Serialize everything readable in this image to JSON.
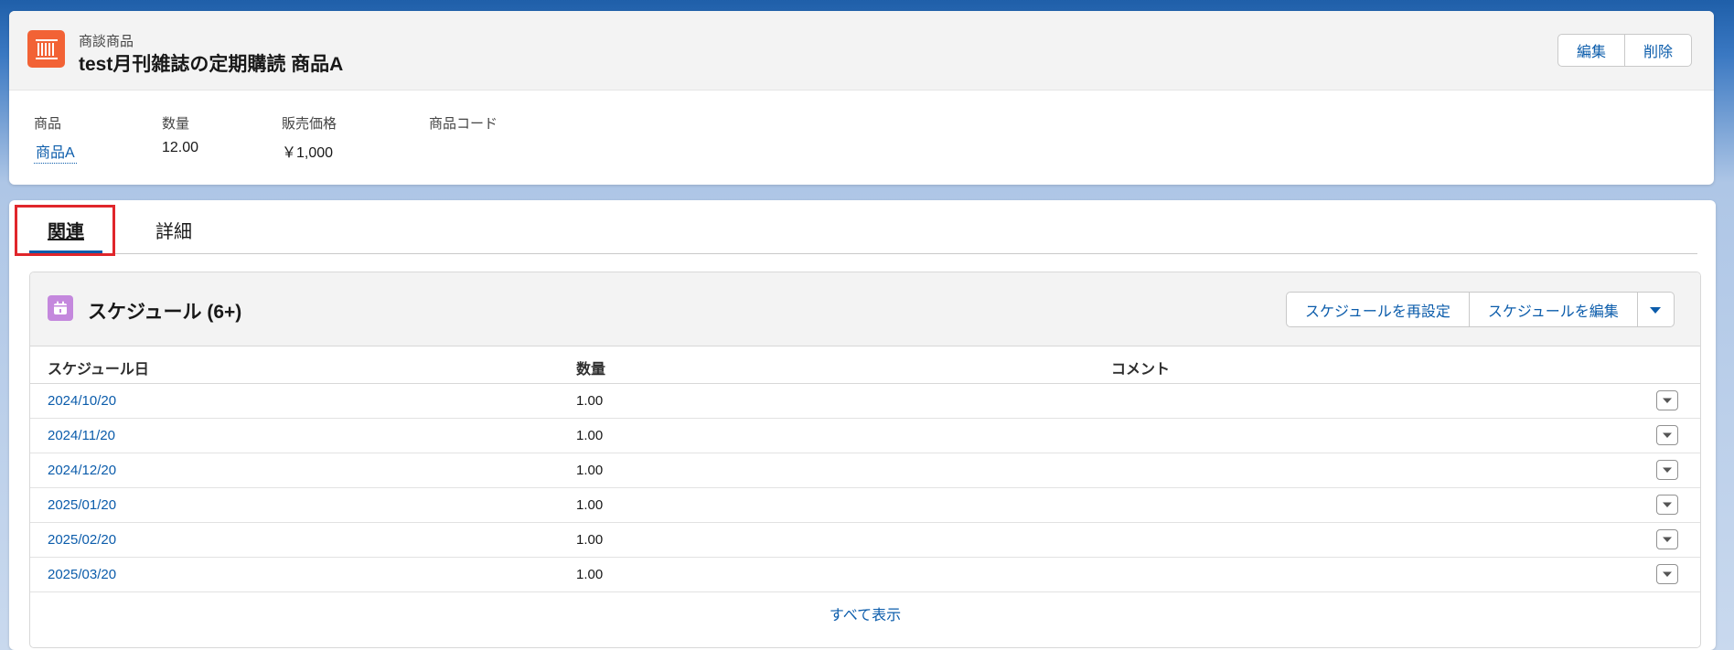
{
  "header": {
    "object_label": "商談商品",
    "title": "test月刊雑誌の定期購読 商品A",
    "actions": {
      "edit": "編集",
      "delete": "削除"
    },
    "fields": [
      {
        "label": "商品",
        "value": "商品A"
      },
      {
        "label": "数量",
        "value": "12.00"
      },
      {
        "label": "販売価格",
        "value": "￥1,000"
      },
      {
        "label": "商品コード",
        "value": ""
      }
    ]
  },
  "tabs": [
    {
      "label": "関連",
      "active": true
    },
    {
      "label": "詳細",
      "active": false
    }
  ],
  "schedule": {
    "title": "スケジュール (6+)",
    "actions": {
      "reset": "スケジュールを再設定",
      "edit": "スケジュールを編集"
    },
    "columns": [
      "スケジュール日",
      "数量",
      "コメント"
    ],
    "rows": [
      {
        "date": "2024/10/20",
        "qty": "1.00",
        "comment": ""
      },
      {
        "date": "2024/11/20",
        "qty": "1.00",
        "comment": ""
      },
      {
        "date": "2024/12/20",
        "qty": "1.00",
        "comment": ""
      },
      {
        "date": "2025/01/20",
        "qty": "1.00",
        "comment": ""
      },
      {
        "date": "2025/02/20",
        "qty": "1.00",
        "comment": ""
      },
      {
        "date": "2025/03/20",
        "qty": "1.00",
        "comment": ""
      }
    ],
    "view_all": "すべて表示"
  },
  "icons": {
    "record": "product-barcode-icon",
    "schedule": "calendar-icon",
    "dropdown": "chevron-down-icon"
  },
  "colors": {
    "brand_link": "#0b5cab",
    "record_icon": "#f26235",
    "schedule_icon": "#c488dd",
    "highlight_box": "#e0262b"
  }
}
